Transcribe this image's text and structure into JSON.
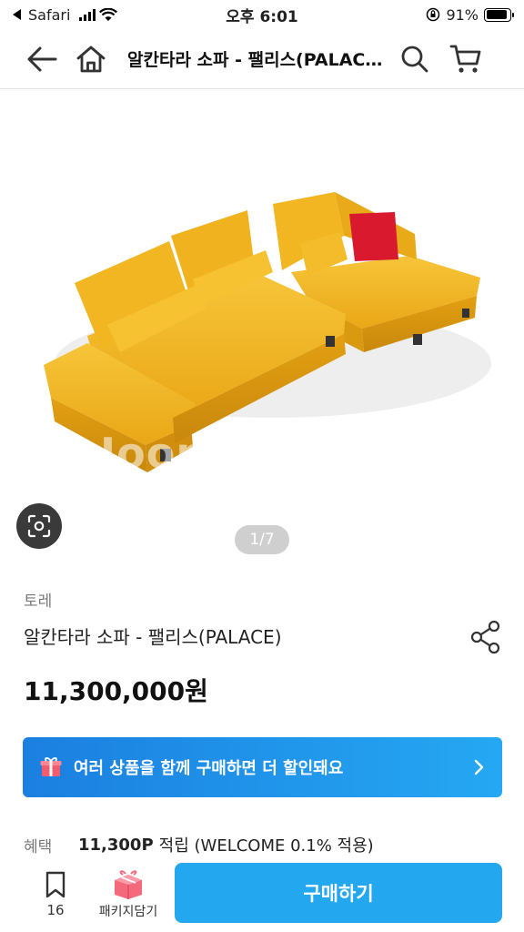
{
  "status_bar": {
    "app_name": "Safari",
    "time": "오후 6:01",
    "battery_percent": "91%",
    "battery_level": 0.91
  },
  "header": {
    "title": "알칸타라 소파 - 팰리스(PALACE)",
    "icons": [
      "arrow-left-icon",
      "home-icon",
      "search-icon",
      "cart-icon"
    ]
  },
  "gallery": {
    "watermark": "Joongang",
    "page_indicator": "1/7",
    "colors": {
      "sofa": "#F3B623",
      "pillow_accent": "#D8192E"
    }
  },
  "product": {
    "brand": "토레",
    "name": "알칸타라 소파 - 팰리스(PALACE)",
    "price": "11,300,000원"
  },
  "bundle_banner": {
    "text": "여러 상품을 함께 구매하면 더 할인돼요",
    "icon": "gift-box-icon",
    "colors": {
      "start": "#1B7FE0",
      "end": "#25A8F3"
    }
  },
  "benefit": {
    "label": "혜택",
    "points": "11,300P",
    "description": "적립 (WELCOME 0.1% 적용)"
  },
  "bottom_bar": {
    "bookmark_count": "16",
    "package_label": "패키지담기",
    "buy_label": "구매하기",
    "buy_color": "#23A8EF"
  }
}
